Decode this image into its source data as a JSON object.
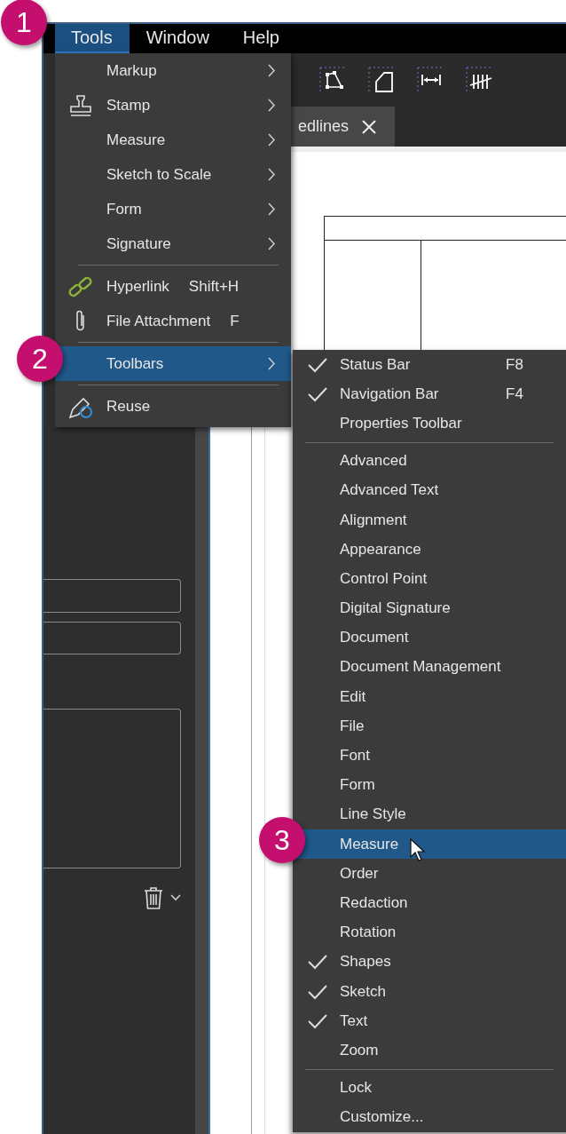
{
  "callouts": [
    "1",
    "2",
    "3"
  ],
  "menu_bar": [
    {
      "label": "Tools",
      "selected": true
    },
    {
      "label": "Window",
      "selected": false
    },
    {
      "label": "Help",
      "selected": false
    }
  ],
  "document_tab": {
    "label": "edlines"
  },
  "tools_menu": [
    {
      "kind": "item",
      "label": "Markup",
      "submenu": true,
      "selected": false
    },
    {
      "kind": "item",
      "label": "Stamp",
      "submenu": true,
      "selected": false
    },
    {
      "kind": "item",
      "label": "Measure",
      "submenu": true,
      "selected": false
    },
    {
      "kind": "item",
      "label": "Sketch to Scale",
      "submenu": true,
      "selected": false
    },
    {
      "kind": "item",
      "label": "Form",
      "submenu": true,
      "selected": false
    },
    {
      "kind": "item",
      "label": "Signature",
      "submenu": true,
      "selected": false
    },
    {
      "kind": "separator"
    },
    {
      "kind": "item",
      "label": "Hyperlink",
      "shortcut": "Shift+H",
      "submenu": false,
      "selected": false
    },
    {
      "kind": "item",
      "label": "File Attachment",
      "shortcut": "F",
      "submenu": false,
      "selected": false
    },
    {
      "kind": "separator"
    },
    {
      "kind": "item",
      "label": "Toolbars",
      "submenu": true,
      "selected": true
    },
    {
      "kind": "separator"
    },
    {
      "kind": "item",
      "label": "Reuse",
      "submenu": false,
      "selected": false
    }
  ],
  "toolbars_submenu": [
    {
      "kind": "item",
      "label": "Status Bar",
      "shortcut": "F8",
      "checked": true,
      "selected": false
    },
    {
      "kind": "item",
      "label": "Navigation Bar",
      "shortcut": "F4",
      "checked": true,
      "selected": false
    },
    {
      "kind": "item",
      "label": "Properties Toolbar",
      "checked": false,
      "selected": false
    },
    {
      "kind": "separator"
    },
    {
      "kind": "item",
      "label": "Advanced",
      "checked": false,
      "selected": false
    },
    {
      "kind": "item",
      "label": "Advanced Text",
      "checked": false,
      "selected": false
    },
    {
      "kind": "item",
      "label": "Alignment",
      "checked": false,
      "selected": false
    },
    {
      "kind": "item",
      "label": "Appearance",
      "checked": false,
      "selected": false
    },
    {
      "kind": "item",
      "label": "Control Point",
      "checked": false,
      "selected": false
    },
    {
      "kind": "item",
      "label": "Digital Signature",
      "checked": false,
      "selected": false
    },
    {
      "kind": "item",
      "label": "Document",
      "checked": false,
      "selected": false
    },
    {
      "kind": "item",
      "label": "Document Management",
      "checked": false,
      "selected": false
    },
    {
      "kind": "item",
      "label": "Edit",
      "checked": false,
      "selected": false
    },
    {
      "kind": "item",
      "label": "File",
      "checked": false,
      "selected": false
    },
    {
      "kind": "item",
      "label": "Font",
      "checked": false,
      "selected": false
    },
    {
      "kind": "item",
      "label": "Form",
      "checked": false,
      "selected": false
    },
    {
      "kind": "item",
      "label": "Line Style",
      "checked": false,
      "selected": false
    },
    {
      "kind": "item",
      "label": "Measure",
      "checked": false,
      "selected": true
    },
    {
      "kind": "item",
      "label": "Order",
      "checked": false,
      "selected": false
    },
    {
      "kind": "item",
      "label": "Redaction",
      "checked": false,
      "selected": false
    },
    {
      "kind": "item",
      "label": "Rotation",
      "checked": false,
      "selected": false
    },
    {
      "kind": "item",
      "label": "Shapes",
      "checked": true,
      "selected": false
    },
    {
      "kind": "item",
      "label": "Sketch",
      "checked": true,
      "selected": false
    },
    {
      "kind": "item",
      "label": "Text",
      "checked": true,
      "selected": false
    },
    {
      "kind": "item",
      "label": "Zoom",
      "checked": false,
      "selected": false
    },
    {
      "kind": "separator"
    },
    {
      "kind": "item",
      "label": "Lock",
      "checked": false,
      "selected": false
    },
    {
      "kind": "item",
      "label": "Customize...",
      "checked": false,
      "selected": false
    }
  ]
}
